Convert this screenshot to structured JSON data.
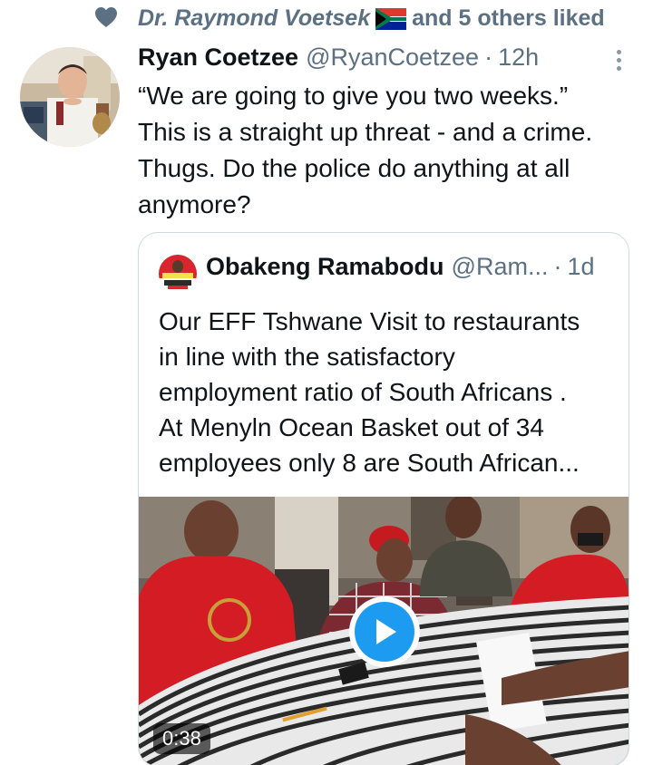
{
  "social_context": {
    "liker_name": "Dr. Raymond Voetsek",
    "flag": "south-africa-flag-emoji",
    "rest": "and 5 others liked",
    "icon": "heart-icon"
  },
  "tweet": {
    "author_name": "Ryan Coetzee",
    "author_handle": "@RyanCoetzee",
    "separator": "·",
    "time": "12h",
    "more_icon": "more-vertical-icon",
    "text_lines": [
      "“We are going to give you two weeks.”",
      "This is a straight up threat - and a crime.",
      "Thugs. Do the police do anything at all",
      "anymore?"
    ]
  },
  "quoted_tweet": {
    "author_name": "Obakeng Ramabodu",
    "author_handle": "@Ram...",
    "separator": "·",
    "time": "1d",
    "text_lines": [
      "Our EFF Tshwane Visit to restaurants",
      "in line with the satisfactory",
      "employment ratio of South Africans .",
      "At Menyln Ocean Basket out of 34",
      "employees only 8 are South African..."
    ],
    "media": {
      "type": "video",
      "duration": "0:38",
      "play_icon": "play-icon"
    }
  },
  "colors": {
    "secondary_text": "#5b7083",
    "accent_blue": "#1d9bf0",
    "border": "#cfd9de"
  }
}
